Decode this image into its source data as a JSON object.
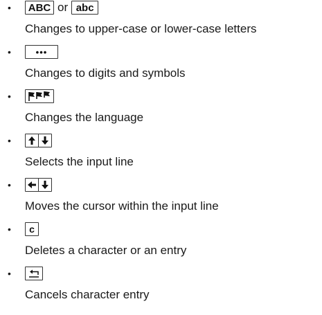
{
  "items": [
    {
      "keys": [
        "ABC",
        "abc"
      ],
      "connector": "or",
      "description": "Changes to upper-case or lower-case letters"
    },
    {
      "keys": [
        "•••"
      ],
      "description": "Changes to digits and symbols"
    },
    {
      "key_icons": [
        "flags-icon"
      ],
      "description": "Changes the language"
    },
    {
      "key_icons": [
        "arrow-up-icon",
        "arrow-down-icon"
      ],
      "description": "Selects the input line"
    },
    {
      "key_icons": [
        "arrow-left-icon",
        "arrow-down-icon"
      ],
      "description": "Moves the cursor within the input line"
    },
    {
      "keys": [
        "c"
      ],
      "description": "Deletes a character or an entry"
    },
    {
      "key_icons": [
        "back-icon"
      ],
      "description": "Cancels character entry"
    }
  ],
  "bullet_char": "•"
}
